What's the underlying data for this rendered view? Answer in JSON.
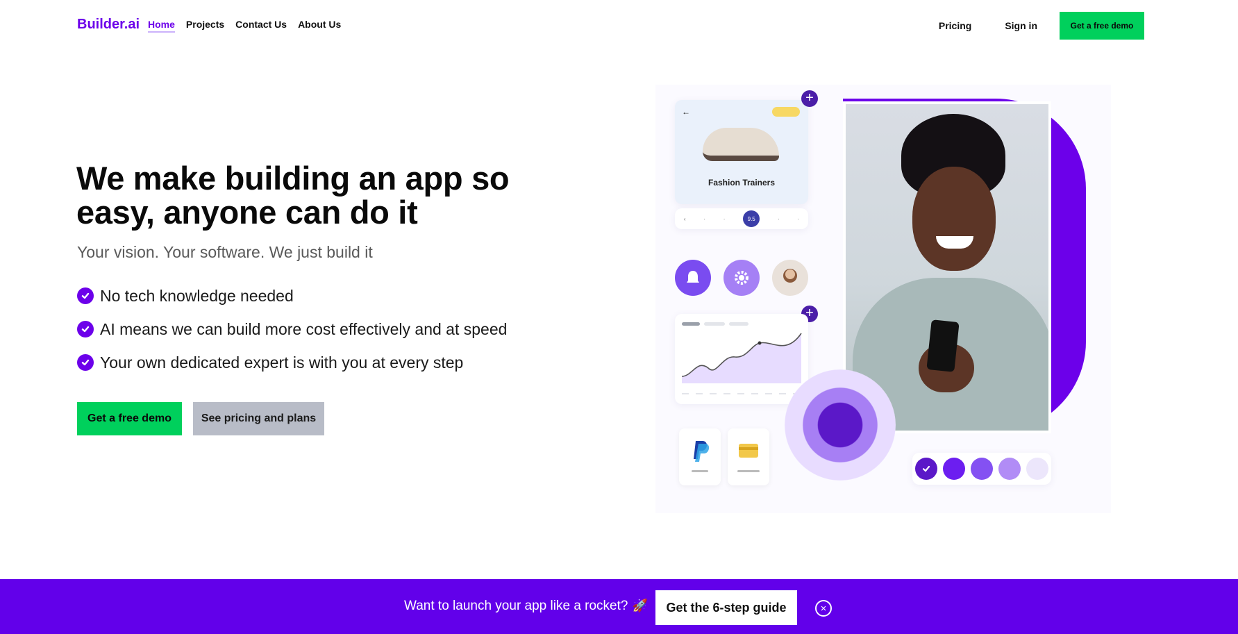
{
  "nav": {
    "logo": "Builder.ai",
    "links": [
      "Home",
      "Projects",
      "Contact Us",
      "About Us"
    ],
    "pricing": "Pricing",
    "signin": "Sign in",
    "demo": "Get a free demo"
  },
  "hero": {
    "title": "We make building an app so easy, anyone can do it",
    "subtitle": "Your vision. Your software. We just build it",
    "features": [
      "No tech knowledge needed",
      "AI means we can build more cost effectively and at speed",
      "Your own dedicated expert is with you at every step"
    ],
    "cta_demo": "Get a free demo",
    "cta_pricing": "See pricing and plans"
  },
  "illustration": {
    "product_label": "Fashion Trainers",
    "selected_size": "9.5"
  },
  "banner": {
    "text": "Want to launch your app like a rocket?",
    "button": "Get the 6-step guide",
    "rocket_icon": "🚀",
    "close_icon": "×"
  },
  "colors": {
    "brand_purple": "#6c00ea",
    "cta_green": "#00d05c",
    "banner_purple": "#6200ea"
  }
}
